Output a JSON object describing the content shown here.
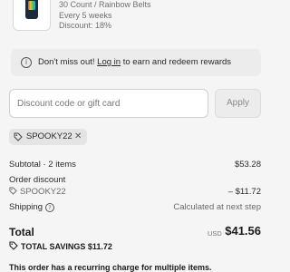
{
  "product": {
    "meta_lines": [
      "30 Count / Rainbow Belts",
      "Every 5 weeks",
      "Discount: 18%"
    ]
  },
  "banner": {
    "text_before": "Don't miss out! ",
    "link_text": "Log in",
    "text_after": " to earn and redeem rewards"
  },
  "discount": {
    "placeholder": "Discount code or gift card",
    "apply_label": "Apply",
    "applied_code": "SPOOKY22",
    "remove_glyph": "✕"
  },
  "summary": {
    "subtotal_label": "Subtotal · 2 items",
    "subtotal_value": "$53.28",
    "order_discount_label": "Order discount",
    "discount_code": "SPOOKY22",
    "discount_value": "– $11.72",
    "shipping_label": "Shipping",
    "shipping_value": "Calculated at next step",
    "total_label": "Total",
    "currency": "USD",
    "total_value": "$41.56",
    "savings_label": "TOTAL SAVINGS",
    "savings_value": "$11.72",
    "recurring_note": "This order has a recurring charge for multiple items."
  },
  "icons": {
    "info": "info-icon",
    "tag": "tag-icon",
    "question": "question-icon",
    "close": "close-icon"
  }
}
